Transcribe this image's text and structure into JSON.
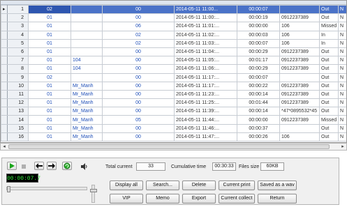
{
  "grid": {
    "rows": [
      {
        "n": "1",
        "c1": "02",
        "c2": "",
        "c3": "00",
        "date": "2014-05-11 11:00...",
        "dur": "00:00:07",
        "num": "",
        "dir": "Out",
        "tail": "N"
      },
      {
        "n": "2",
        "c1": "01",
        "c2": "",
        "c3": "00",
        "date": "2014-05-11 11:00:...",
        "dur": "00:00:19",
        "num": "0912237389",
        "dir": "Out",
        "tail": "N"
      },
      {
        "n": "3",
        "c1": "01",
        "c2": "",
        "c3": "06",
        "date": "2014-05-11 11:01:...",
        "dur": "00:00:00",
        "num": "106",
        "dir": "Missed",
        "tail": "N"
      },
      {
        "n": "4",
        "c1": "01",
        "c2": "",
        "c3": "02",
        "date": "2014-05-11 11:02:...",
        "dur": "00:00:03",
        "num": "106",
        "dir": "In",
        "tail": "N"
      },
      {
        "n": "5",
        "c1": "01",
        "c2": "",
        "c3": "02",
        "date": "2014-05-11 11:03:...",
        "dur": "00:00:07",
        "num": "106",
        "dir": "In",
        "tail": "N"
      },
      {
        "n": "6",
        "c1": "01",
        "c2": "",
        "c3": "00",
        "date": "2014-05-11 11:04:...",
        "dur": "00:00:29",
        "num": "0912237389",
        "dir": "Out",
        "tail": "N"
      },
      {
        "n": "7",
        "c1": "01",
        "c2": "104",
        "c3": "00",
        "date": "2014-05-11 11:05:...",
        "dur": "00:01:17",
        "num": "0912237389",
        "dir": "Out",
        "tail": "N"
      },
      {
        "n": "8",
        "c1": "01",
        "c2": "104",
        "c3": "00",
        "date": "2014-05-11 11:06:...",
        "dur": "00:00:29",
        "num": "0912237389",
        "dir": "Out",
        "tail": "N"
      },
      {
        "n": "9",
        "c1": "02",
        "c2": "",
        "c3": "00",
        "date": "2014-05-11 11:17:...",
        "dur": "00:00:07",
        "num": "",
        "dir": "Out",
        "tail": "N"
      },
      {
        "n": "10",
        "c1": "01",
        "c2": "Mr_Manh",
        "c3": "00",
        "date": "2014-05-11 11:17:...",
        "dur": "00:00:22",
        "num": "0912237389",
        "dir": "Out",
        "tail": "N"
      },
      {
        "n": "11",
        "c1": "01",
        "c2": "Mr_Manh",
        "c3": "00",
        "date": "2014-05-11 11:23:...",
        "dur": "00:00:14",
        "num": "0912237389",
        "dir": "Out",
        "tail": "N"
      },
      {
        "n": "12",
        "c1": "01",
        "c2": "Mr_Manh",
        "c3": "00",
        "date": "2014-05-11 11:25:...",
        "dur": "00:01:44",
        "num": "0912237389",
        "dir": "Out",
        "tail": "N"
      },
      {
        "n": "13",
        "c1": "01",
        "c2": "Mr_Manh",
        "c3": "00",
        "date": "2014-05-11 11:39:...",
        "dur": "00:00:14",
        "num": "*47*0895532*45",
        "dir": "Out",
        "tail": "N"
      },
      {
        "n": "14",
        "c1": "01",
        "c2": "Mr_Manh",
        "c3": "05",
        "date": "2014-05-11 11:44:...",
        "dur": "00:00:00",
        "num": "0912237389",
        "dir": "Missed",
        "tail": "N"
      },
      {
        "n": "15",
        "c1": "01",
        "c2": "Mr_Manh",
        "c3": "00",
        "date": "2014-05-11 11:46:...",
        "dur": "00:00:37",
        "num": "",
        "dir": "Out",
        "tail": "N"
      },
      {
        "n": "16",
        "c1": "01",
        "c2": "Mr_Manh",
        "c3": "00",
        "date": "2014-05-11 11:47:...",
        "dur": "00:00:26",
        "num": "106",
        "dir": "Out",
        "tail": "N"
      }
    ]
  },
  "scroll": {
    "left": "◂",
    "right": "▸"
  },
  "player": {
    "play_icon": "play-icon",
    "stop_icon": "stop-icon",
    "back_icon": "rewind-icon",
    "fwd_icon": "forward-icon",
    "loop_icon": "loop-icon",
    "speaker_icon": "speaker-icon",
    "time": "00:00:07.7",
    "progress": 0.0,
    "volume": 0.75
  },
  "stats": {
    "total_label": "Total current",
    "total_value": "33",
    "cum_label": "Cumulative time",
    "cum_value": "00:30:33",
    "size_label": "Files size",
    "size_value": "60KB"
  },
  "buttons": {
    "display_all": "Display all",
    "search": "Search...",
    "delete": "Delete",
    "current_print": "Current print",
    "saved_wav": "Saved as a wav",
    "vip": "VIP",
    "memo": "Memo",
    "export": "Export",
    "current_collect": "Current collect",
    "return": "Return"
  },
  "colors": {
    "selection": "#4a72c8",
    "link_text": "#1f4fb8",
    "lcd_text": "#31e83a"
  }
}
